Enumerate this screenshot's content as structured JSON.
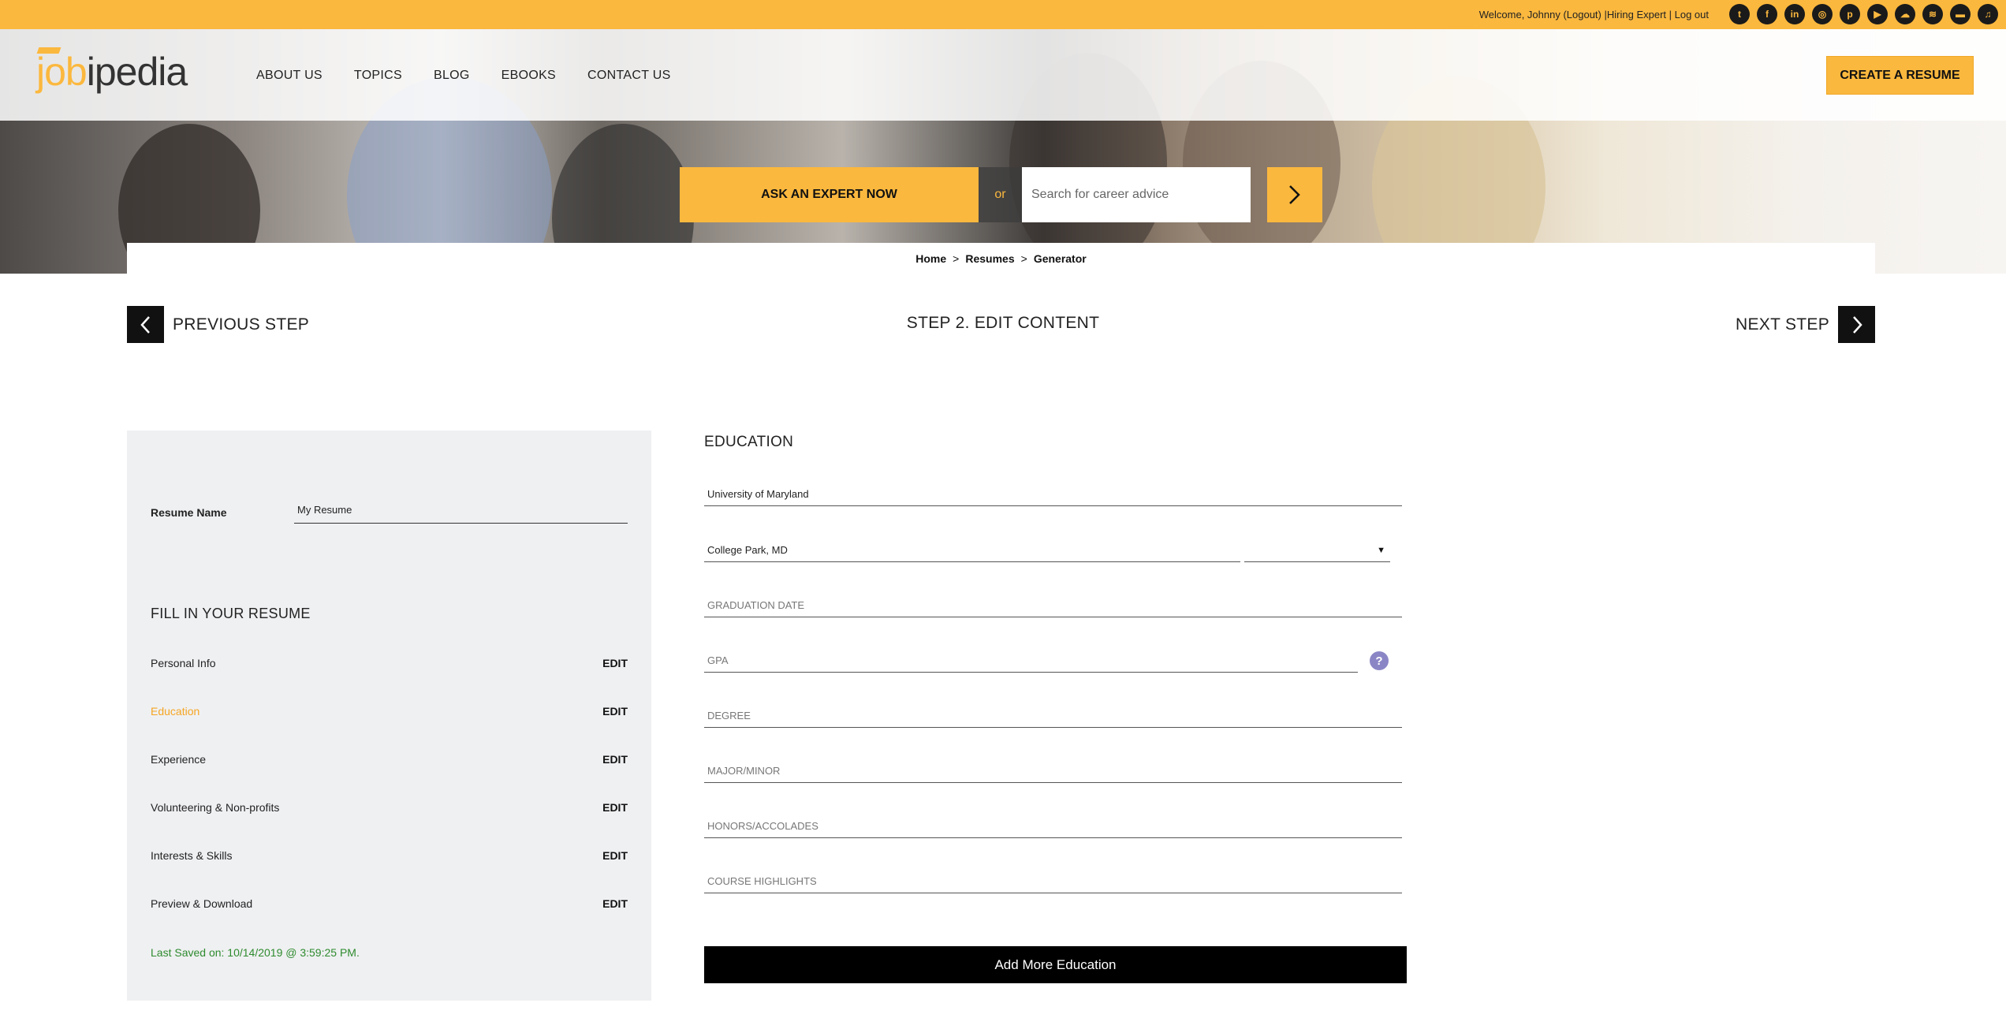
{
  "topbar": {
    "welcome": "Welcome, Johnny (Logout)",
    "links": "|Hiring Expert | Log out",
    "social_icons": [
      "twitter-icon",
      "facebook-icon",
      "linkedin-icon",
      "instagram-icon",
      "pinterest-icon",
      "youtube-icon",
      "soundcloud-icon",
      "spotify-icon",
      "stitcher-icon",
      "itunes-icon"
    ],
    "social_glyphs": [
      "t",
      "f",
      "in",
      "◎",
      "p",
      "▶",
      "☁",
      "≋",
      "▬",
      "♫"
    ]
  },
  "header": {
    "logo_job": "job",
    "logo_rest": "ipedia",
    "nav": [
      "ABOUT US",
      "TOPICS",
      "BLOG",
      "EBOOKS",
      "CONTACT US"
    ],
    "create_resume": "CREATE A RESUME"
  },
  "hero": {
    "ask_expert": "ASK AN EXPERT NOW",
    "or": "or",
    "search_placeholder": "Search for career advice"
  },
  "breadcrumb": [
    "Home",
    "Resumes",
    "Generator"
  ],
  "steps": {
    "previous": "PREVIOUS STEP",
    "current": "STEP 2. EDIT CONTENT",
    "next": "NEXT STEP"
  },
  "sidebar": {
    "resume_name_label": "Resume Name",
    "resume_name_value": "My Resume",
    "fill_title": "FILL IN YOUR RESUME",
    "items": [
      {
        "label": "Personal Info",
        "edit": "EDIT"
      },
      {
        "label": "Education",
        "edit": "EDIT"
      },
      {
        "label": "Experience",
        "edit": "EDIT"
      },
      {
        "label": "Volunteering & Non-profits",
        "edit": "EDIT"
      },
      {
        "label": "Interests & Skills",
        "edit": "EDIT"
      },
      {
        "label": "Preview & Download",
        "edit": "EDIT"
      }
    ],
    "last_saved": "Last Saved on: 10/14/2019 @ 3:59:25 PM."
  },
  "education": {
    "title": "EDUCATION",
    "school_value": "University of Maryland",
    "location_value": "College Park, MD",
    "state_value": "",
    "graduation_placeholder": "GRADUATION DATE",
    "gpa_placeholder": "GPA",
    "degree_placeholder": "DEGREE",
    "major_placeholder": "MAJOR/MINOR",
    "honors_placeholder": "HONORS/ACCOLADES",
    "courses_placeholder": "COURSE HIGHLIGHTS",
    "help": "?",
    "add_more": "Add More Education"
  },
  "colors": {
    "accent": "#FBB83E",
    "active_step": "#F5A623",
    "saved_text": "#2e8b2e",
    "help_icon": "#8a86c6"
  }
}
